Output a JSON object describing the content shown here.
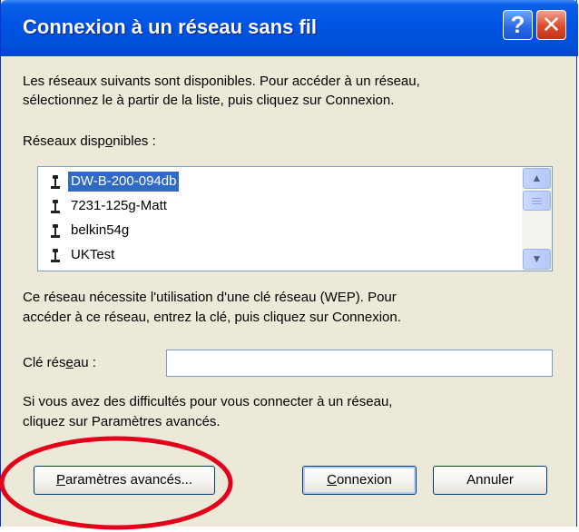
{
  "window": {
    "title": "Connexion à un réseau sans fil",
    "help_label": "?",
    "close_label": "✕"
  },
  "intro": {
    "line1": "Les réseaux suivants sont disponibles. Pour accéder à un réseau,",
    "line2": "sélectionnez le à partir de la liste, puis cliquez sur Connexion."
  },
  "networks": {
    "label_pre": "Réseaux disp",
    "label_underline": "o",
    "label_post": "nibles :",
    "items": [
      {
        "name": "DW-B-200-094db",
        "selected": true,
        "icon": "antenna-icon"
      },
      {
        "name": "7231-125g-Matt",
        "selected": false,
        "icon": "antenna-icon"
      },
      {
        "name": "belkin54g",
        "selected": false,
        "icon": "antenna-icon"
      },
      {
        "name": "UKTest",
        "selected": false,
        "icon": "antenna-icon"
      }
    ]
  },
  "wep_notice": {
    "line1": "Ce réseau nécessite l'utilisation d'une clé réseau (WEP). Pour",
    "line2": "accéder à ce réseau, entrez la clé, puis cliquez sur Connexion."
  },
  "network_key": {
    "label_pre": "Clé rés",
    "label_underline": "e",
    "label_post": "au :",
    "value": ""
  },
  "help_text": {
    "line1": "Si vous avez des difficultés pour vous connecter à un réseau,",
    "line2": "cliquez sur Paramètres avancés."
  },
  "buttons": {
    "advanced": {
      "underline": "P",
      "rest": "aramètres avancés..."
    },
    "connect": {
      "underline": "C",
      "rest": "onnexion"
    },
    "cancel": {
      "label": "Annuler"
    }
  },
  "colors": {
    "title_bar": "#0054e3",
    "selection": "#316ac5",
    "dialog_bg": "#ece9d8",
    "annotation": "#e3001b"
  }
}
